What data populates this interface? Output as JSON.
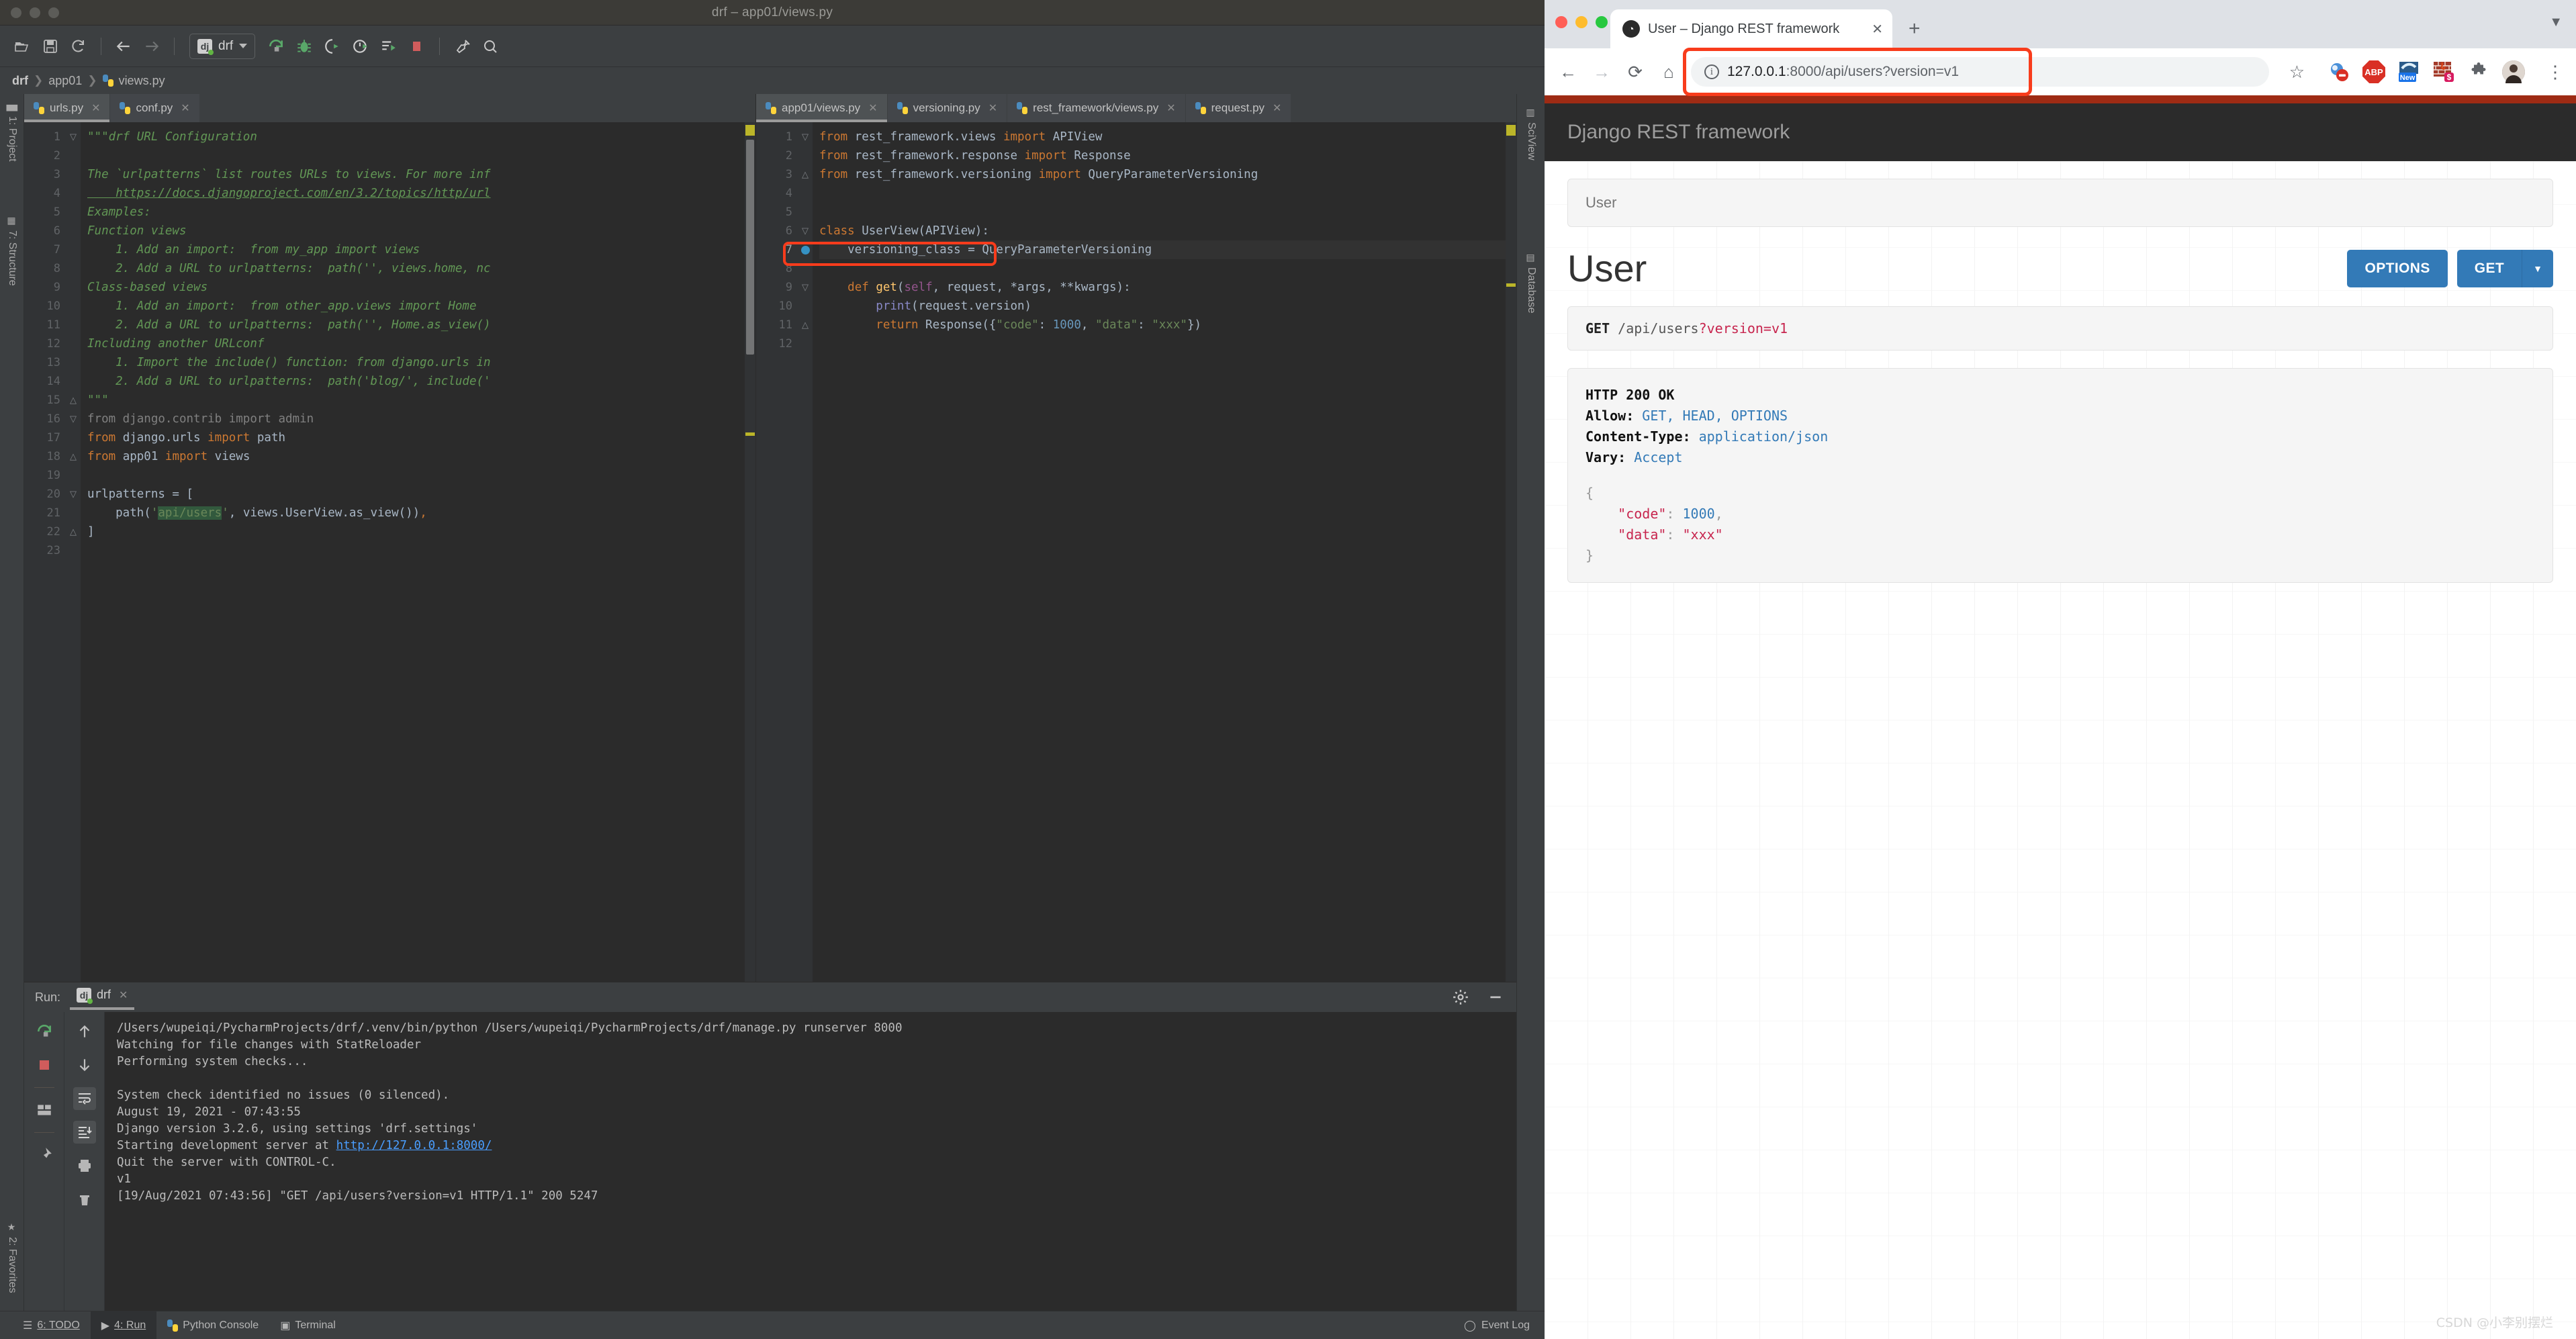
{
  "ide": {
    "window_title": "drf – app01/views.py",
    "toolbar": {
      "run_config_name": "drf",
      "icons": [
        "open-folder-icon",
        "save-icon",
        "sync-icon",
        "back-arrow-icon",
        "forward-arrow-icon",
        "rerun-icon",
        "debug-icon",
        "run-with-coverage-icon",
        "profile-icon",
        "run-todo-icon",
        "stop-icon",
        "settings-wrench-icon",
        "search-icon"
      ]
    },
    "breadcrumbs": [
      "drf",
      "app01",
      "views.py"
    ],
    "left_rail": [
      {
        "label": "1: Project",
        "icon": "project-icon"
      },
      {
        "label": "7: Structure",
        "icon": "structure-icon"
      },
      {
        "label": "2: Favorites",
        "icon": "star-icon"
      }
    ],
    "right_rail": [
      {
        "label": "SciView",
        "icon": "sciview-icon"
      },
      {
        "label": "Database",
        "icon": "database-icon"
      }
    ],
    "left_editor": {
      "tabs": [
        {
          "label": "urls.py",
          "active": true
        },
        {
          "label": "conf.py",
          "active": false
        }
      ],
      "lines": [
        {
          "n": 1,
          "fold": "▽",
          "segs": [
            {
              "t": "\"\"\"drf URL Configuration",
              "c": "c-com"
            }
          ]
        },
        {
          "n": 2,
          "fold": "",
          "segs": []
        },
        {
          "n": 3,
          "fold": "",
          "segs": [
            {
              "t": "The `urlpatterns` list routes URLs to views. For more inf",
              "c": "c-com"
            }
          ]
        },
        {
          "n": 4,
          "fold": "",
          "segs": [
            {
              "t": "    https://docs.djangoproject.com/en/3.2/topics/http/url",
              "c": "c-link"
            }
          ]
        },
        {
          "n": 5,
          "fold": "",
          "segs": [
            {
              "t": "Examples:",
              "c": "c-com"
            }
          ]
        },
        {
          "n": 6,
          "fold": "",
          "segs": [
            {
              "t": "Function views",
              "c": "c-com"
            }
          ]
        },
        {
          "n": 7,
          "fold": "",
          "segs": [
            {
              "t": "    1. Add an import:  from my_app import views",
              "c": "c-com"
            }
          ]
        },
        {
          "n": 8,
          "fold": "",
          "segs": [
            {
              "t": "    2. Add a URL to urlpatterns:  path('', views.home, nc",
              "c": "c-com"
            }
          ]
        },
        {
          "n": 9,
          "fold": "",
          "segs": [
            {
              "t": "Class-based views",
              "c": "c-com"
            }
          ]
        },
        {
          "n": 10,
          "fold": "",
          "segs": [
            {
              "t": "    1. Add an import:  from other_app.views import Home",
              "c": "c-com"
            }
          ]
        },
        {
          "n": 11,
          "fold": "",
          "segs": [
            {
              "t": "    2. Add a URL to urlpatterns:  path('', Home.as_view()",
              "c": "c-com"
            }
          ]
        },
        {
          "n": 12,
          "fold": "",
          "segs": [
            {
              "t": "Including another URLconf",
              "c": "c-com"
            }
          ]
        },
        {
          "n": 13,
          "fold": "",
          "segs": [
            {
              "t": "    1. Import the include() function: from django.urls in",
              "c": "c-com"
            }
          ]
        },
        {
          "n": 14,
          "fold": "",
          "segs": [
            {
              "t": "    2. Add a URL to urlpatterns:  path('blog/', include('",
              "c": "c-com"
            }
          ]
        },
        {
          "n": 15,
          "fold": "△",
          "segs": [
            {
              "t": "\"\"\"",
              "c": "c-com"
            }
          ]
        },
        {
          "n": 16,
          "fold": "▽",
          "segs": [
            {
              "t": "from django.contrib import admin",
              "c": "c-muted"
            }
          ]
        },
        {
          "n": 17,
          "fold": "",
          "segs": [
            {
              "t": "from",
              "c": "c-kw"
            },
            {
              "t": " django.urls ",
              "c": "c-txt"
            },
            {
              "t": "import",
              "c": "c-kw"
            },
            {
              "t": " path",
              "c": "c-txt"
            }
          ]
        },
        {
          "n": 18,
          "fold": "△",
          "segs": [
            {
              "t": "from",
              "c": "c-kw"
            },
            {
              "t": " app01 ",
              "c": "c-txt"
            },
            {
              "t": "import",
              "c": "c-kw"
            },
            {
              "t": " views",
              "c": "c-txt"
            }
          ]
        },
        {
          "n": 19,
          "fold": "",
          "segs": []
        },
        {
          "n": 20,
          "fold": "▽",
          "segs": [
            {
              "t": "urlpatterns = [",
              "c": "c-txt"
            }
          ]
        },
        {
          "n": 21,
          "fold": "",
          "segs": [
            {
              "t": "    path(",
              "c": "c-txt"
            },
            {
              "t": "'",
              "c": "c-str"
            },
            {
              "t": "api/users",
              "c": "c-str hl-str"
            },
            {
              "t": "'",
              "c": "c-str"
            },
            {
              "t": ", views.UserView.as_view())",
              "c": "c-txt"
            },
            {
              "t": ",",
              "c": "c-kw"
            }
          ]
        },
        {
          "n": 22,
          "fold": "△",
          "segs": [
            {
              "t": "]",
              "c": "c-txt"
            }
          ]
        },
        {
          "n": 23,
          "fold": "",
          "segs": []
        }
      ]
    },
    "right_editor": {
      "tabs": [
        {
          "label": "app01/views.py",
          "active": true
        },
        {
          "label": "versioning.py",
          "active": false
        },
        {
          "label": "rest_framework/views.py",
          "active": false
        },
        {
          "label": "request.py",
          "active": false
        }
      ],
      "highlight_line": 7,
      "lines": [
        {
          "n": 1,
          "fold": "▽",
          "segs": [
            {
              "t": "from",
              "c": "c-kw"
            },
            {
              "t": " rest_framework.views ",
              "c": "c-txt"
            },
            {
              "t": "import",
              "c": "c-kw"
            },
            {
              "t": " APIView",
              "c": "c-txt"
            }
          ]
        },
        {
          "n": 2,
          "fold": "",
          "segs": [
            {
              "t": "from",
              "c": "c-kw"
            },
            {
              "t": " rest_framework.response ",
              "c": "c-txt"
            },
            {
              "t": "import",
              "c": "c-kw"
            },
            {
              "t": " Response",
              "c": "c-txt"
            }
          ]
        },
        {
          "n": 3,
          "fold": "△",
          "segs": [
            {
              "t": "from",
              "c": "c-kw"
            },
            {
              "t": " rest_framework.versioning ",
              "c": "c-txt"
            },
            {
              "t": "import",
              "c": "c-kw"
            },
            {
              "t": " QueryParameterVersioning",
              "c": "c-txt"
            }
          ]
        },
        {
          "n": 4,
          "fold": "",
          "segs": []
        },
        {
          "n": 5,
          "fold": "",
          "segs": []
        },
        {
          "n": 6,
          "fold": "▽",
          "segs": [
            {
              "t": "class",
              "c": "c-kw"
            },
            {
              "t": " UserView(APIView):",
              "c": "c-txt"
            }
          ]
        },
        {
          "n": 7,
          "fold": "",
          "segs": [
            {
              "t": "    versioning_class = QueryParameterVersioning",
              "c": "c-txt"
            }
          ]
        },
        {
          "n": 8,
          "fold": "",
          "segs": []
        },
        {
          "n": 9,
          "fold": "▽",
          "segs": [
            {
              "t": "    ",
              "c": "c-txt"
            },
            {
              "t": "def",
              "c": "c-kw"
            },
            {
              "t": " ",
              "c": "c-txt"
            },
            {
              "t": "get",
              "c": "c-fn"
            },
            {
              "t": "(",
              "c": "c-txt"
            },
            {
              "t": "self",
              "c": "c-self"
            },
            {
              "t": ", request, *args, **kwargs):",
              "c": "c-txt"
            }
          ]
        },
        {
          "n": 10,
          "fold": "",
          "segs": [
            {
              "t": "        ",
              "c": "c-txt"
            },
            {
              "t": "print",
              "c": "c-builtin"
            },
            {
              "t": "(request.version)",
              "c": "c-txt"
            }
          ]
        },
        {
          "n": 11,
          "fold": "△",
          "segs": [
            {
              "t": "        ",
              "c": "c-txt"
            },
            {
              "t": "return",
              "c": "c-kw"
            },
            {
              "t": " Response({",
              "c": "c-txt"
            },
            {
              "t": "\"code\"",
              "c": "c-str"
            },
            {
              "t": ": ",
              "c": "c-txt"
            },
            {
              "t": "1000",
              "c": "c-num"
            },
            {
              "t": ", ",
              "c": "c-txt"
            },
            {
              "t": "\"data\"",
              "c": "c-str"
            },
            {
              "t": ": ",
              "c": "c-txt"
            },
            {
              "t": "\"xxx\"",
              "c": "c-str"
            },
            {
              "t": "})",
              "c": "c-txt"
            }
          ]
        },
        {
          "n": 12,
          "fold": "",
          "segs": []
        }
      ]
    },
    "run_panel": {
      "label": "Run:",
      "tab_name": "drf",
      "left_tools": [
        "rerun-icon",
        "stop-icon",
        "layout-icon",
        "pin-icon"
      ],
      "right_tools": [
        "scroll-up-icon",
        "scroll-down-icon",
        "soft-wrap-icon",
        "scroll-to-end-icon",
        "print-icon",
        "trash-icon"
      ],
      "header_icons": [
        "gear-icon",
        "minimize-icon"
      ],
      "console": [
        {
          "t": "/Users/wupeiqi/PycharmProjects/drf/.venv/bin/python /Users/wupeiqi/PycharmProjects/drf/manage.py runserver 8000",
          "c": ""
        },
        {
          "t": "Watching for file changes with StatReloader",
          "c": "cl-red"
        },
        {
          "t": "Performing system checks...",
          "c": ""
        },
        {
          "t": "",
          "c": ""
        },
        {
          "t": "System check identified no issues (0 silenced).",
          "c": ""
        },
        {
          "t": "August 19, 2021 - 07:43:55",
          "c": ""
        },
        {
          "t": "Django version 3.2.6, using settings 'drf.settings'",
          "c": ""
        },
        {
          "t": "Starting development server at http://127.0.0.1:8000/",
          "c": "",
          "link": "http://127.0.0.1:8000/"
        },
        {
          "t": "Quit the server with CONTROL-C.",
          "c": ""
        },
        {
          "t": "v1",
          "c": ""
        },
        {
          "t": "[19/Aug/2021 07:43:56] \"GET /api/users?version=v1 HTTP/1.1\" 200 5247",
          "c": "cl-red"
        }
      ]
    },
    "statusbar": {
      "items": [
        {
          "label": "6: TODO",
          "icon": "todo-icon",
          "active": false
        },
        {
          "label": "4: Run",
          "icon": "run-icon",
          "active": true
        },
        {
          "label": "Python Console",
          "icon": "python-icon",
          "active": false
        },
        {
          "label": "Terminal",
          "icon": "terminal-icon",
          "active": false
        }
      ],
      "right_label": "Event Log",
      "right_icon": "event-log-icon"
    }
  },
  "browser": {
    "tab_title": "User – Django REST framework",
    "new_tab_label": "+",
    "nav": {
      "back": "←",
      "forward": "→",
      "reload": "⟳",
      "home": "⌂"
    },
    "url_display": "127.0.0.1:8000/api/users?version=v1",
    "url_host": "127.0.0.1",
    "url_rest": ":8000/api/users?version=v1",
    "extensions": [
      "privacy-badger-icon",
      "ABP",
      "New",
      "firewall-icon",
      "puzzle-extensions-icon"
    ],
    "avatar": "profile-avatar",
    "menu_icon": "kebab-menu-icon",
    "star_icon": "bookmark-star-icon",
    "page": {
      "brand": "Django REST framework",
      "breadcrumb": "User",
      "title": "User",
      "options_button": "OPTIONS",
      "get_button": "GET",
      "get_caret": "▼",
      "request_method": "GET",
      "request_path": "/api/users",
      "request_query": "?version=v1",
      "response": {
        "status": "HTTP 200 OK",
        "headers": [
          {
            "key": "Allow:",
            "value": "GET, HEAD, OPTIONS"
          },
          {
            "key": "Content-Type:",
            "value": "application/json"
          },
          {
            "key": "Vary:",
            "value": "Accept"
          }
        ],
        "body_open": "{",
        "body_lines": [
          {
            "key": "\"code\"",
            "sep": ": ",
            "val": "1000",
            "val_class": "jn",
            "comma": ","
          },
          {
            "key": "\"data\"",
            "sep": ": ",
            "val": "\"xxx\"",
            "val_class": "jv",
            "comma": ""
          }
        ],
        "body_close": "}"
      }
    },
    "watermark": "CSDN @小李别摆烂"
  },
  "colors": {
    "drf_blue": "#337ab7",
    "annotation_red": "#f83c1c",
    "drf_header_bg": "#2b2b2b",
    "ide_bg": "#3c3f41",
    "editor_bg": "#2b2b2b"
  }
}
